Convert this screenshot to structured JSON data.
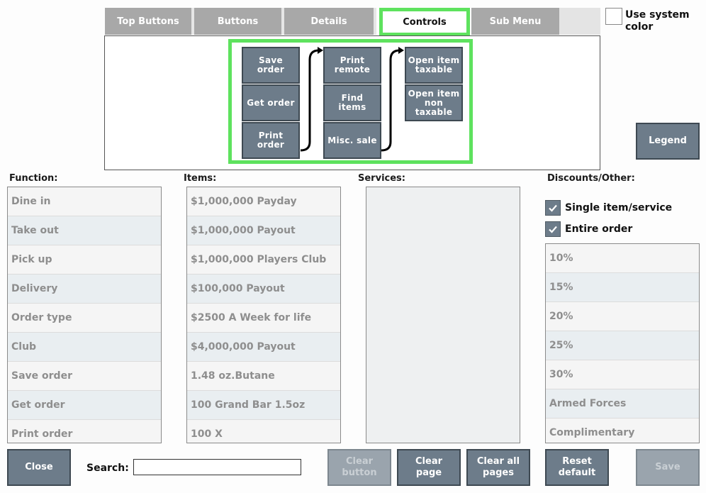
{
  "tabs": [
    {
      "label": "Top Buttons",
      "active": false
    },
    {
      "label": "Buttons",
      "active": false
    },
    {
      "label": "Details",
      "active": false
    },
    {
      "label": "Controls",
      "active": true
    },
    {
      "label": "Sub Menu",
      "active": false
    }
  ],
  "use_system_color": {
    "label": "Use system color",
    "checked": false
  },
  "controls": {
    "col1": [
      "Save order",
      "Get order",
      "Print order"
    ],
    "col2": [
      "Print remote",
      "Find items",
      "Misc. sale"
    ],
    "col3": [
      "Open item taxable",
      "Open item non taxable"
    ]
  },
  "legend_label": "Legend",
  "function": {
    "label": "Function:",
    "items": [
      "Dine in",
      "Take out",
      "Pick up",
      "Delivery",
      "Order type",
      "Club",
      "Save order",
      "Get order",
      "Print order"
    ]
  },
  "items": {
    "label": "Items:",
    "items": [
      "$1,000,000 Payday",
      "$1,000,000 Payout",
      "$1,000,000 Players Club",
      "$100,000 Payout",
      "$2500 A Week for life",
      "$4,000,000 Payout",
      "1.48 oz.Butane",
      "100 Grand Bar 1.5oz",
      "100 X"
    ]
  },
  "services": {
    "label": "Services:",
    "items": []
  },
  "discounts": {
    "label": "Discounts/Other:",
    "single_item": {
      "label": "Single item/service",
      "checked": true
    },
    "entire_order": {
      "label": "Entire order",
      "checked": true
    },
    "items": [
      "10%",
      "15%",
      "20%",
      "25%",
      "30%",
      "Armed Forces",
      "Complimentary"
    ]
  },
  "bottom": {
    "close": "Close",
    "search_label": "Search:",
    "search_value": "",
    "clear_button": "Clear button",
    "clear_page": "Clear page",
    "clear_all_pages": "Clear all pages",
    "reset_default": "Reset default",
    "save": "Save"
  },
  "colors": {
    "button": "#6d7c8a",
    "highlight": "#5ee25e",
    "tab": "#a8a8a8"
  }
}
